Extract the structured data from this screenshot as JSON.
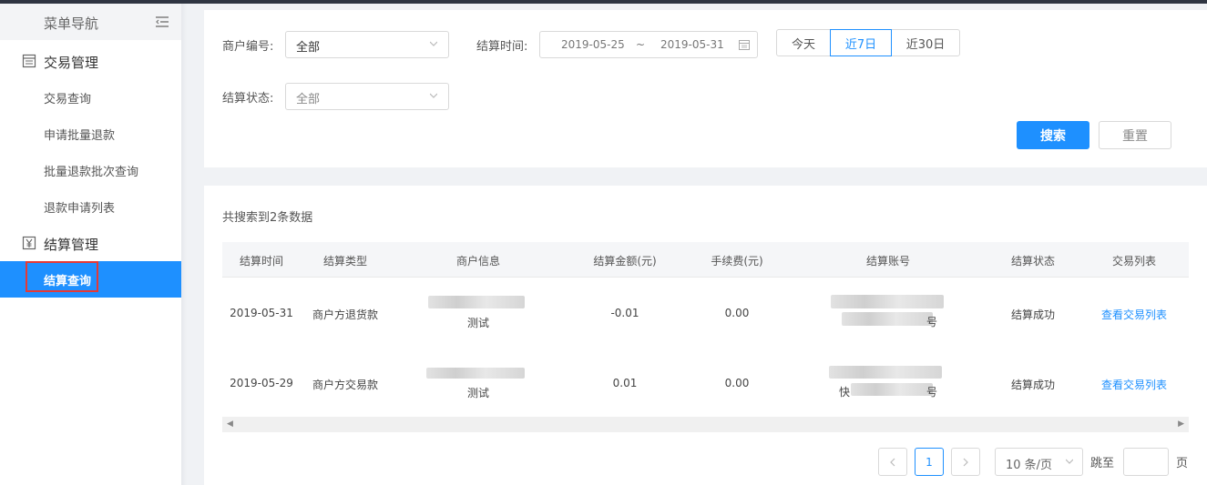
{
  "sidebar": {
    "title": "菜单导航",
    "groups": [
      {
        "label": "交易管理",
        "icon": "document-icon",
        "items": [
          {
            "label": "交易查询"
          },
          {
            "label": "申请批量退款"
          },
          {
            "label": "批量退款批次查询"
          },
          {
            "label": "退款申请列表"
          }
        ]
      },
      {
        "label": "结算管理",
        "icon": "yen-icon",
        "items": [
          {
            "label": "结算查询"
          }
        ]
      }
    ]
  },
  "filters": {
    "merchant_label": "商户编号:",
    "merchant_value": "全部",
    "time_label": "结算时间:",
    "date_start": "2019-05-25",
    "date_sep": "~",
    "date_end": "2019-05-31",
    "quick_ranges": [
      "今天",
      "近7日",
      "近30日"
    ],
    "quick_selected": "近7日",
    "status_label": "结算状态:",
    "status_value": "全部",
    "search_label": "搜索",
    "reset_label": "重置"
  },
  "results": {
    "count_text": "共搜索到2条数据",
    "columns": [
      "结算时间",
      "结算类型",
      "商户信息",
      "结算金额(元)",
      "手续费(元)",
      "结算账号",
      "结算状态",
      "交易列表"
    ],
    "rows": [
      {
        "time": "2019-05-31",
        "type": "商户方退货款",
        "merchant": "测试",
        "amount": "-0.01",
        "fee": "0.00",
        "account_tail": "号",
        "account_head": "",
        "status": "结算成功",
        "action": "查看交易列表"
      },
      {
        "time": "2019-05-29",
        "type": "商户方交易款",
        "merchant": "测试",
        "amount": "0.01",
        "fee": "0.00",
        "account_tail": "号",
        "account_head": "快",
        "status": "结算成功",
        "action": "查看交易列表"
      }
    ]
  },
  "pagination": {
    "current_page": "1",
    "page_size": "10 条/页",
    "jump_label": "跳至",
    "page_suffix": "页"
  },
  "colors": {
    "primary": "#1e90ff",
    "sidebar_active": "#1e90ff",
    "highlight_box": "#e53935"
  }
}
